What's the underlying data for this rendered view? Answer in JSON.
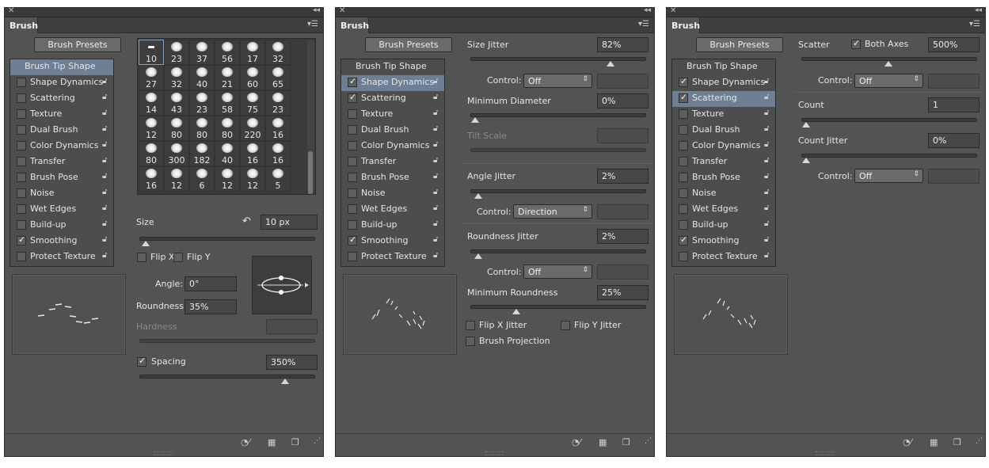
{
  "panel_title": "Brush",
  "brush_presets_label": "Brush Presets",
  "options": [
    "Brush Tip Shape",
    "Shape Dynamics",
    "Scattering",
    "Texture",
    "Dual Brush",
    "Color Dynamics",
    "Transfer",
    "Brush Pose",
    "Noise",
    "Wet Edges",
    "Build-up",
    "Smoothing",
    "Protect Texture"
  ],
  "panel1": {
    "checked": {
      "Smoothing": true
    },
    "tips": [
      "10",
      "23",
      "37",
      "56",
      "17",
      "32",
      "27",
      "32",
      "40",
      "21",
      "60",
      "65",
      "14",
      "43",
      "23",
      "58",
      "75",
      "23",
      "12",
      "80",
      "80",
      "80",
      "220",
      "16",
      "80",
      "300",
      "182",
      "40",
      "16",
      "16",
      "16",
      "12",
      "6",
      "12",
      "12",
      "5"
    ],
    "size_label": "Size",
    "size_value": "10 px",
    "flip_x": "Flip X",
    "flip_y": "Flip Y",
    "angle_label": "Angle:",
    "angle_value": "0°",
    "roundness_label": "Roundness:",
    "roundness_value": "35%",
    "hardness_label": "Hardness",
    "spacing_label": "Spacing",
    "spacing_value": "350%",
    "spacing_checked": true
  },
  "panel2": {
    "checked": {
      "Shape Dynamics": true,
      "Scattering": true,
      "Smoothing": true
    },
    "size_jitter_label": "Size Jitter",
    "size_jitter_value": "82%",
    "control_label": "Control:",
    "control1": "Off",
    "min_diameter_label": "Minimum Diameter",
    "min_diameter_value": "0%",
    "tilt_scale_label": "Tilt Scale",
    "angle_jitter_label": "Angle Jitter",
    "angle_jitter_value": "2%",
    "control2": "Direction",
    "roundness_jitter_label": "Roundness Jitter",
    "roundness_jitter_value": "2%",
    "control3": "Off",
    "min_roundness_label": "Minimum Roundness",
    "min_roundness_value": "25%",
    "flip_x_jitter": "Flip X Jitter",
    "flip_y_jitter": "Flip Y Jitter",
    "brush_projection": "Brush Projection",
    "slider_levels": {
      "size_jitter": 0.82,
      "min_diameter": 0,
      "angle_jitter": 0.02,
      "roundness_jitter": 0.02,
      "min_roundness": 0.25
    }
  },
  "panel3": {
    "checked": {
      "Shape Dynamics": true,
      "Scattering": true,
      "Smoothing": true
    },
    "scatter_label": "Scatter",
    "both_axes_label": "Both Axes",
    "scatter_value": "500%",
    "control_label": "Control:",
    "control1": "Off",
    "count_label": "Count",
    "count_value": "1",
    "count_jitter_label": "Count Jitter",
    "count_jitter_value": "0%",
    "control2": "Off",
    "slider_levels": {
      "scatter": 0.5,
      "count": 0,
      "count_jitter": 0
    }
  },
  "colors": {
    "panel_bg": "#535353",
    "selected_row": "#6e7f93",
    "field_bg": "#474747"
  }
}
